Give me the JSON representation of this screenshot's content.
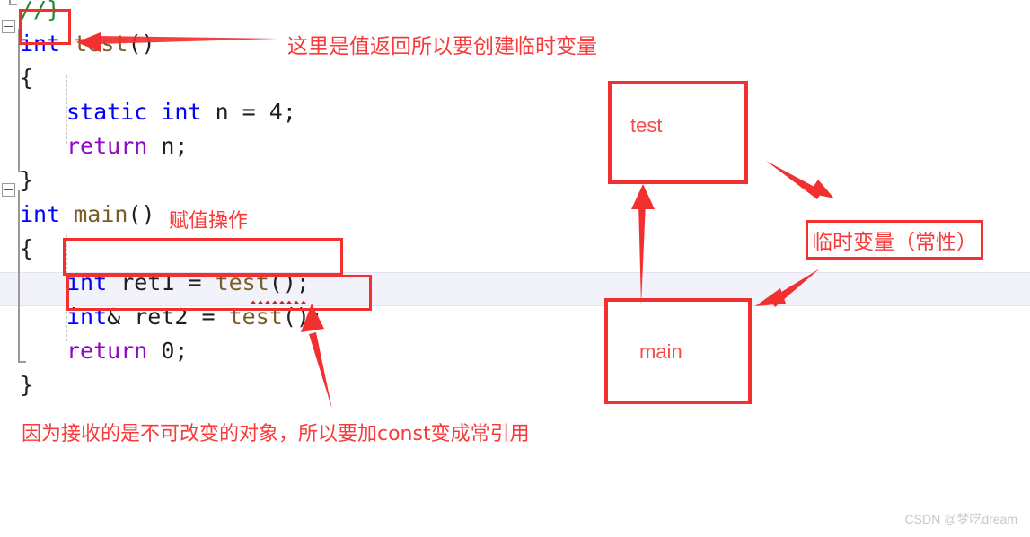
{
  "editor": {
    "lines": [
      {
        "indent": 0,
        "tokens": [
          {
            "t": "//}",
            "c": "cmt"
          }
        ]
      },
      {
        "indent": 0,
        "tokens": [
          {
            "t": "int",
            "c": "kw"
          },
          {
            "t": " ",
            "c": "plain"
          },
          {
            "t": "test",
            "c": "fn"
          },
          {
            "t": "()",
            "c": "plain"
          }
        ]
      },
      {
        "indent": 0,
        "tokens": [
          {
            "t": "{",
            "c": "plain"
          }
        ]
      },
      {
        "indent": 1,
        "tokens": [
          {
            "t": "static int",
            "c": "kw"
          },
          {
            "t": " n = 4;",
            "c": "plain"
          }
        ]
      },
      {
        "indent": 1,
        "tokens": [
          {
            "t": "return",
            "c": "ctl"
          },
          {
            "t": " n;",
            "c": "plain"
          }
        ]
      },
      {
        "indent": 0,
        "tokens": [
          {
            "t": "}",
            "c": "plain"
          }
        ]
      },
      {
        "indent": 0,
        "tokens": [
          {
            "t": "int",
            "c": "kw"
          },
          {
            "t": " ",
            "c": "plain"
          },
          {
            "t": "main",
            "c": "fn"
          },
          {
            "t": "()",
            "c": "plain"
          }
        ]
      },
      {
        "indent": 0,
        "tokens": [
          {
            "t": "{",
            "c": "plain"
          }
        ]
      },
      {
        "indent": 1,
        "tokens": [
          {
            "t": "int",
            "c": "kw"
          },
          {
            "t": " ret1 = ",
            "c": "plain"
          },
          {
            "t": "test",
            "c": "fn"
          },
          {
            "t": "();",
            "c": "plain"
          }
        ]
      },
      {
        "indent": 1,
        "tokens": [
          {
            "t": "int",
            "c": "kw"
          },
          {
            "t": "& ret2 = ",
            "c": "plain"
          },
          {
            "t": "test",
            "c": "fn"
          },
          {
            "t": "();",
            "c": "plain"
          }
        ]
      },
      {
        "indent": 1,
        "tokens": [
          {
            "t": "return",
            "c": "ctl"
          },
          {
            "t": " 0;",
            "c": "plain"
          }
        ]
      },
      {
        "indent": 0,
        "tokens": [
          {
            "t": "}",
            "c": "plain"
          }
        ]
      }
    ]
  },
  "annotations": {
    "return_note": "这里是值返回所以要创建临时变量",
    "assign_note": "赋值操作",
    "const_note": "因为接收的是不可改变的对象，所以要加const变成常引用",
    "temp_var_label": "临时变量（常性）"
  },
  "diagram": {
    "test_box_label": "test",
    "main_box_label": "main"
  },
  "watermark": "CSDN @梦呓dream",
  "colors": {
    "annotation_red": "#f23030",
    "annotation_text_red": "#f83a3a",
    "keyword_blue": "#0000ff",
    "control_purple": "#8f08c4",
    "function_olive": "#795e26",
    "comment_green": "#1f8a30",
    "current_line": "#f2f2fb"
  }
}
